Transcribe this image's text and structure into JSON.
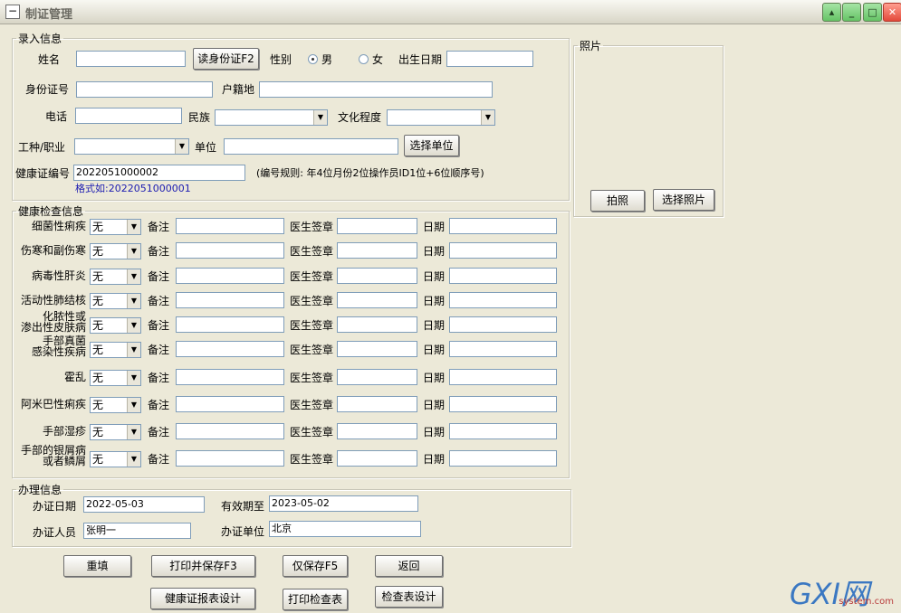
{
  "window": {
    "title": "制证管理"
  },
  "lr": {
    "legend": "录入信息",
    "name_label": "姓名",
    "name_value": "",
    "read_id_btn": "读身份证F2",
    "gender_label": "性别",
    "male": "男",
    "female": "女",
    "birth_label": "出生日期",
    "birth_value": "",
    "id_label": "身份证号",
    "id_value": "",
    "hukou_label": "户籍地",
    "hukou_value": "",
    "phone_label": "电话",
    "phone_value": "",
    "ethnic_label": "民族",
    "ethnic_value": "",
    "edu_label": "文化程度",
    "edu_value": "",
    "job_label": "工种/职业",
    "job_value": "",
    "unit_label": "单位",
    "unit_value": "",
    "select_unit_btn": "选择单位",
    "cert_no_label": "健康证编号",
    "cert_no_value": "2022051000002",
    "cert_no_rule": "(编号规则: 年4位月份2位操作员ID1位+6位顺序号)",
    "cert_no_example": "格式如:2022051000001"
  },
  "photo": {
    "legend": "照片",
    "take_btn": "拍照",
    "choose_btn": "选择照片"
  },
  "health": {
    "legend": "健康检查信息",
    "remark_label": "备注",
    "doctor_label": "医生签章",
    "date_label": "日期",
    "rows": [
      {
        "name": "细菌性痢疾",
        "value": "无"
      },
      {
        "name": "伤寒和副伤寒",
        "value": "无"
      },
      {
        "name": "病毒性肝炎",
        "value": "无"
      },
      {
        "name": "活动性肺结核",
        "value": "无"
      },
      {
        "name": "化脓性或\n渗出性皮肤病",
        "value": "无"
      },
      {
        "name": "手部真菌\n感染性疾病",
        "value": "无"
      },
      {
        "name": "霍乱",
        "value": "无"
      },
      {
        "name": "阿米巴性痢疾",
        "value": "无"
      },
      {
        "name": "手部湿疹",
        "value": "无"
      },
      {
        "name": "手部的银屑病\n或者鳞屑",
        "value": "无"
      }
    ]
  },
  "proc": {
    "legend": "办理信息",
    "date_label": "办证日期",
    "date_value": "2022-05-03",
    "valid_label": "有效期至",
    "valid_value": "2023-05-02",
    "person_label": "办证人员",
    "person_value": "张明一",
    "unit_label": "办证单位",
    "unit_value": "北京"
  },
  "buttons": {
    "reset": "重填",
    "print_save": "打印并保存F3",
    "save_only": "仅保存F5",
    "back": "返回",
    "cert_design": "健康证报表设计",
    "print_check": "打印检查表",
    "check_design": "检查表设计"
  },
  "watermark": {
    "logo": "GXI网",
    "site": "system.com"
  }
}
